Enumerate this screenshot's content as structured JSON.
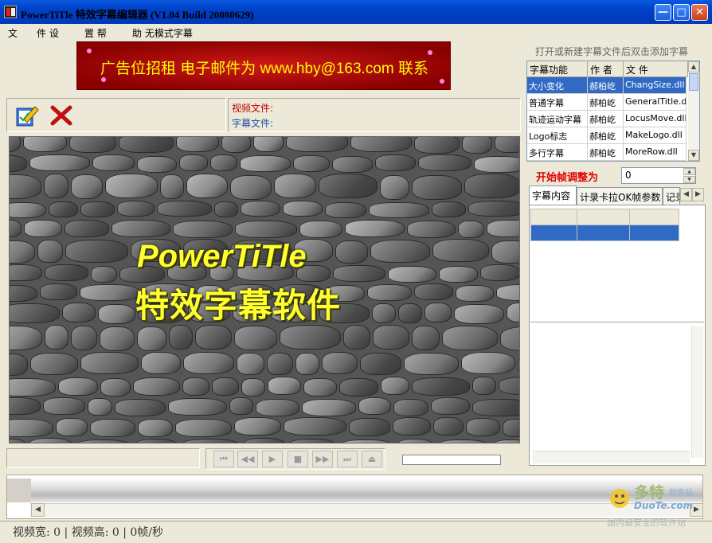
{
  "window": {
    "title": "PowerTiTle  特效字幕编辑器 (V1.04 Build 20080629)",
    "minimize_glyph": "—",
    "maximize_glyph": "□",
    "close_glyph": "✕"
  },
  "menu": {
    "items": [
      "文",
      "件 设",
      "置 帮",
      "助 无模式字幕"
    ]
  },
  "banner": {
    "text": "广告位招租  电子邮件为 www.hby@163.com 联系"
  },
  "toolbar": {
    "open_icon": "edit-icon",
    "delete_icon": "close-icon",
    "video_file_label": "视频文件:",
    "subtitle_file_label": "字幕文件:"
  },
  "preview": {
    "logo_line1": "PowerTiTle",
    "logo_line2": "特效字幕软件"
  },
  "transport": {
    "buttons": [
      "⏮",
      "◀◀",
      "▶",
      "■",
      "▶▶",
      "⏭",
      "⏏"
    ]
  },
  "status": {
    "text": "视频宽: 0  |  视频高: 0  |  0帧/秒"
  },
  "right_panel": {
    "hint": "打开或新建字幕文件后双击添加字幕",
    "table": {
      "headers": [
        "字幕功能",
        "作 者",
        "文 件"
      ],
      "rows": [
        {
          "func": "大小变化",
          "author": "郝柏屹",
          "file": "ChangSize.dll",
          "selected": true
        },
        {
          "func": "普通字幕",
          "author": "郝柏屹",
          "file": "GeneralTitle.dll",
          "selected": false
        },
        {
          "func": "轨迹运动字幕",
          "author": "郝柏屹",
          "file": "LocusMove.dll",
          "selected": false
        },
        {
          "func": "Logo标志",
          "author": "郝柏屹",
          "file": "MakeLogo.dll",
          "selected": false
        },
        {
          "func": "多行字幕",
          "author": "郝柏屹",
          "file": "MoreRow.dll",
          "selected": false
        }
      ]
    },
    "start_frame_label": "开始帧调整为",
    "start_frame_value": "0",
    "tabs": [
      "字幕内容",
      "计录卡拉OK帧参数",
      "记录"
    ]
  },
  "watermark": {
    "line1": "多特",
    "line2": "软件站",
    "line3": "DuoTe.com",
    "line4": "国内最安全的软件站"
  },
  "colors": {
    "title_bar": "#0A5AE0",
    "selection": "#316AC5",
    "start_frame_label": "#E00000",
    "logo_text": "#FFFF30"
  }
}
